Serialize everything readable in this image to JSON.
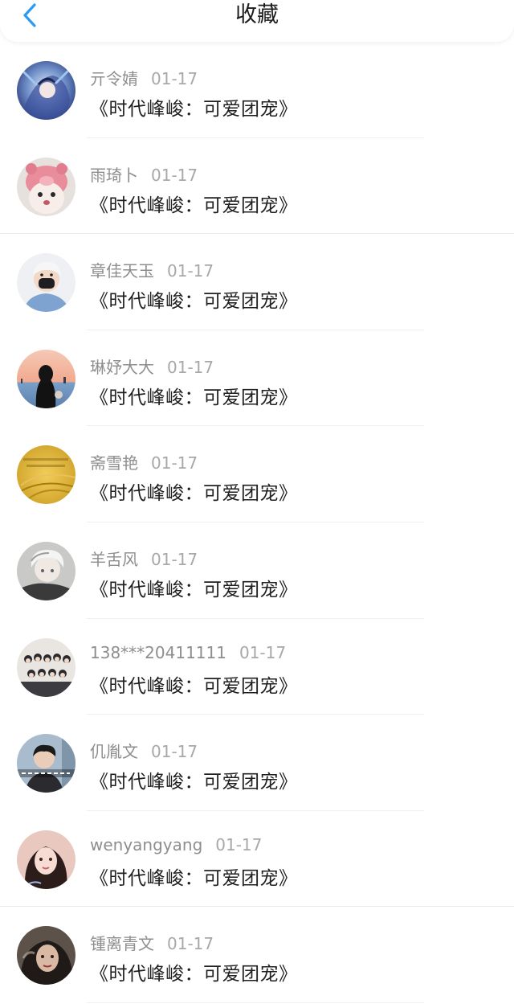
{
  "header": {
    "title": "收藏",
    "back_icon": "chevron-left-icon",
    "accent_color": "#2b9af3"
  },
  "items": [
    {
      "user": "亓令婧",
      "date": "01-17",
      "title": "《时代峰峻：可爱团宠》",
      "avatar_icon": "anime-blue-avatar"
    },
    {
      "user": "雨琦卜",
      "date": "01-17",
      "title": "《时代峰峻：可爱团宠》",
      "avatar_icon": "pink-plush-avatar"
    },
    {
      "user": "章佳天玉",
      "date": "01-17",
      "title": "《时代峰峻：可爱团宠》",
      "avatar_icon": "masked-boy-avatar"
    },
    {
      "user": "琳妤大大",
      "date": "01-17",
      "title": "《时代峰峻：可爱团宠》",
      "avatar_icon": "sunset-girl-avatar"
    },
    {
      "user": "斋雪艳",
      "date": "01-17",
      "title": "《时代峰峻：可爱团宠》",
      "avatar_icon": "wheat-field-avatar"
    },
    {
      "user": "羊舌风",
      "date": "01-17",
      "title": "《时代峰峻：可爱团宠》",
      "avatar_icon": "anime-white-hair-avatar"
    },
    {
      "user": "138***20411111",
      "date": "01-17",
      "title": "《时代峰峻：可爱团宠》",
      "avatar_icon": "group-photo-avatar"
    },
    {
      "user": "仉胤文",
      "date": "01-17",
      "title": "《时代峰峻：可爱团宠》",
      "avatar_icon": "boy-caption-avatar"
    },
    {
      "user": "wenyangyang",
      "date": "01-17",
      "title": "《时代峰峻：可爱团宠》",
      "avatar_icon": "girl-hello-avatar"
    },
    {
      "user": "锺离青文",
      "date": "01-17",
      "title": "《时代峰峻：可爱团宠》",
      "avatar_icon": "dark-portrait-avatar"
    }
  ]
}
